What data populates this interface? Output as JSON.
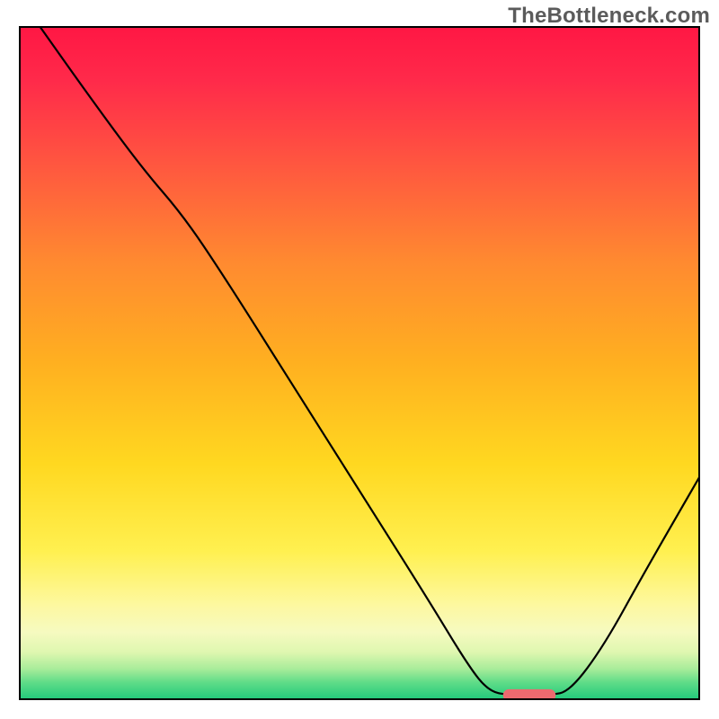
{
  "watermark": "TheBottleneck.com",
  "chart_data": {
    "type": "line",
    "title": "",
    "xlabel": "",
    "ylabel": "",
    "x_range": [
      0,
      100
    ],
    "y_range": [
      0,
      100
    ],
    "gradient_stops": [
      {
        "offset": 0.0,
        "color": "#ff1744"
      },
      {
        "offset": 0.08,
        "color": "#ff2a4a"
      },
      {
        "offset": 0.2,
        "color": "#ff5540"
      },
      {
        "offset": 0.35,
        "color": "#ff8a30"
      },
      {
        "offset": 0.5,
        "color": "#ffb020"
      },
      {
        "offset": 0.65,
        "color": "#ffd820"
      },
      {
        "offset": 0.78,
        "color": "#fff050"
      },
      {
        "offset": 0.86,
        "color": "#fdf8a0"
      },
      {
        "offset": 0.9,
        "color": "#f6fac0"
      },
      {
        "offset": 0.93,
        "color": "#dff7b0"
      },
      {
        "offset": 0.955,
        "color": "#a8ec9a"
      },
      {
        "offset": 0.975,
        "color": "#5fdc88"
      },
      {
        "offset": 1.0,
        "color": "#22c97b"
      }
    ],
    "curve_points": [
      {
        "x": 3,
        "y": 100
      },
      {
        "x": 10,
        "y": 90
      },
      {
        "x": 18,
        "y": 79
      },
      {
        "x": 24,
        "y": 72
      },
      {
        "x": 30,
        "y": 63
      },
      {
        "x": 40,
        "y": 47
      },
      {
        "x": 50,
        "y": 31
      },
      {
        "x": 60,
        "y": 15
      },
      {
        "x": 66,
        "y": 5
      },
      {
        "x": 69,
        "y": 1.2
      },
      {
        "x": 72,
        "y": 0.6
      },
      {
        "x": 78,
        "y": 0.6
      },
      {
        "x": 81,
        "y": 1.2
      },
      {
        "x": 86,
        "y": 8
      },
      {
        "x": 92,
        "y": 19
      },
      {
        "x": 100,
        "y": 33
      }
    ],
    "marker": {
      "x_start": 72,
      "x_end": 78,
      "y": 0.6,
      "color": "#ed6a6f",
      "thickness": 2.2
    },
    "frame_color": "#000000",
    "frame_thickness": 2,
    "curve_color": "#000000",
    "curve_thickness": 2.2,
    "annotations": []
  }
}
